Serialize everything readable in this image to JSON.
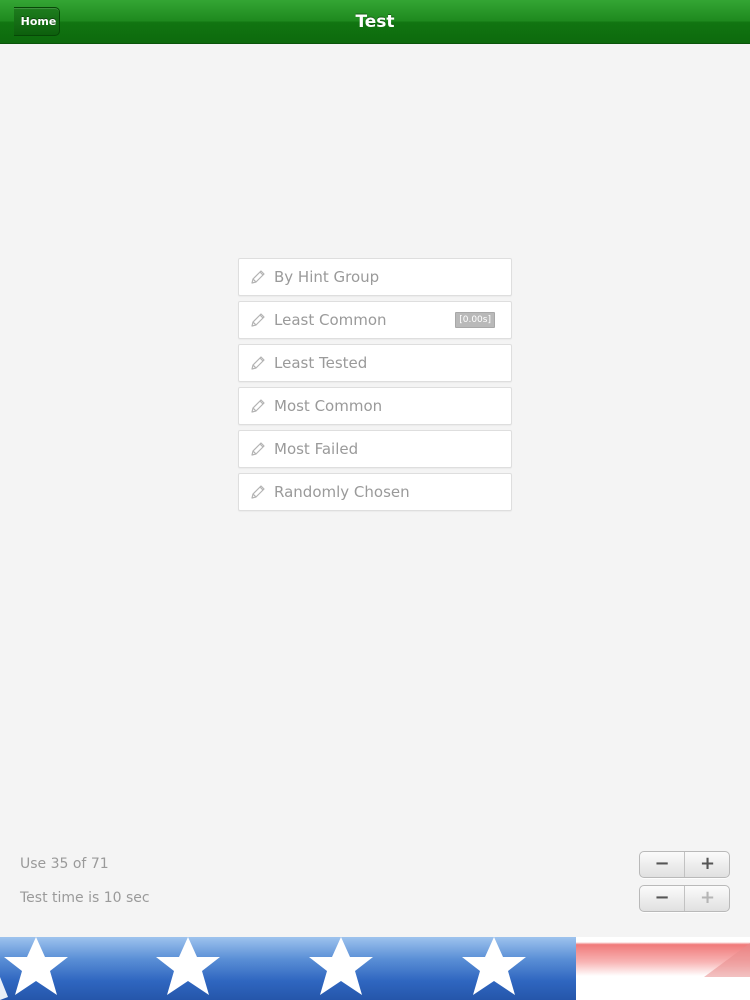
{
  "navbar": {
    "title": "Test",
    "back_label": "Home"
  },
  "menu": {
    "items": [
      {
        "label": "By Hint Group",
        "badge": ""
      },
      {
        "label": "Least Common",
        "badge": "[0.00s]"
      },
      {
        "label": "Least Tested",
        "badge": ""
      },
      {
        "label": "Most Common",
        "badge": ""
      },
      {
        "label": "Most Failed",
        "badge": ""
      },
      {
        "label": "Randomly Chosen",
        "badge": ""
      }
    ],
    "icon": "pencil-icon"
  },
  "settings": {
    "use_count": {
      "label": "Use 35 of 71",
      "minus": "−",
      "plus": "+"
    },
    "test_time": {
      "label": "Test time is 10 sec",
      "minus": "−",
      "plus": "+"
    }
  },
  "colors": {
    "navbar_green": "#1f8a1f",
    "flag_blue": "#2f66c0",
    "flag_red": "#f07a7a",
    "background": "#f4f4f4"
  }
}
